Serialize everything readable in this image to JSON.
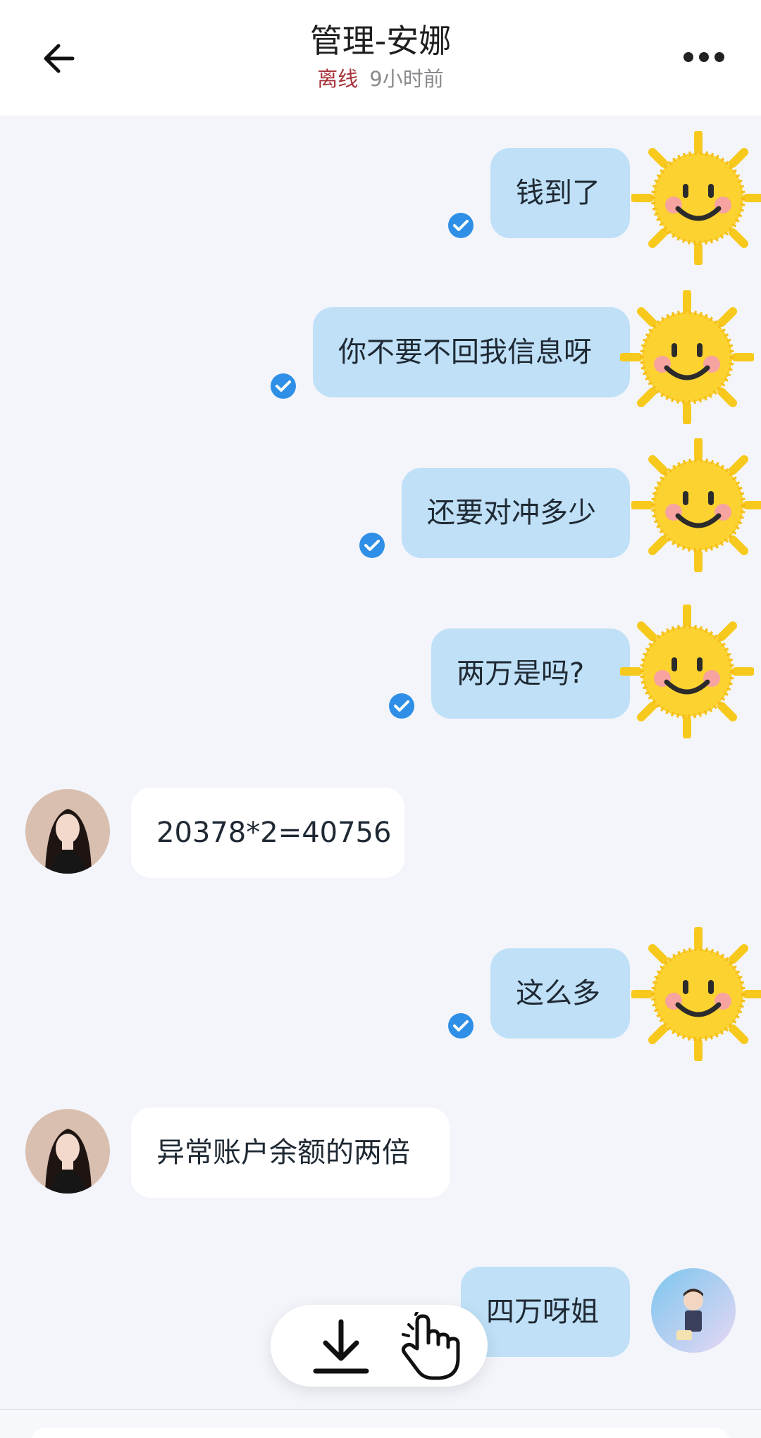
{
  "header": {
    "title": "管理-安娜",
    "status": "离线",
    "last_seen": "9小时前"
  },
  "messages": [
    {
      "side": "out",
      "text": "钱到了",
      "read": true
    },
    {
      "side": "out",
      "text": "你不要不回我信息呀",
      "read": true
    },
    {
      "side": "out",
      "text": "还要对冲多少",
      "read": true
    },
    {
      "side": "out",
      "text": "两万是吗?",
      "read": true
    },
    {
      "side": "in",
      "text": "20378*2=40756"
    },
    {
      "side": "out",
      "text": "这么多",
      "read": true
    },
    {
      "side": "in",
      "text": "异常账户余额的两倍"
    },
    {
      "side": "out",
      "text": "四万呀姐"
    }
  ],
  "icons": {
    "back": "arrow-left-icon",
    "more": "more-horizontal-icon",
    "read": "check-circle-icon",
    "download": "download-icon",
    "hand": "hand-pointer-icon",
    "sticker": "sun-smile-icon"
  },
  "colors": {
    "outgoing_bubble": "#bfe0f7",
    "incoming_bubble": "#ffffff",
    "read_check": "#2f8fe6",
    "offline_status": "#a8323a",
    "background": "#f3f5fa"
  }
}
